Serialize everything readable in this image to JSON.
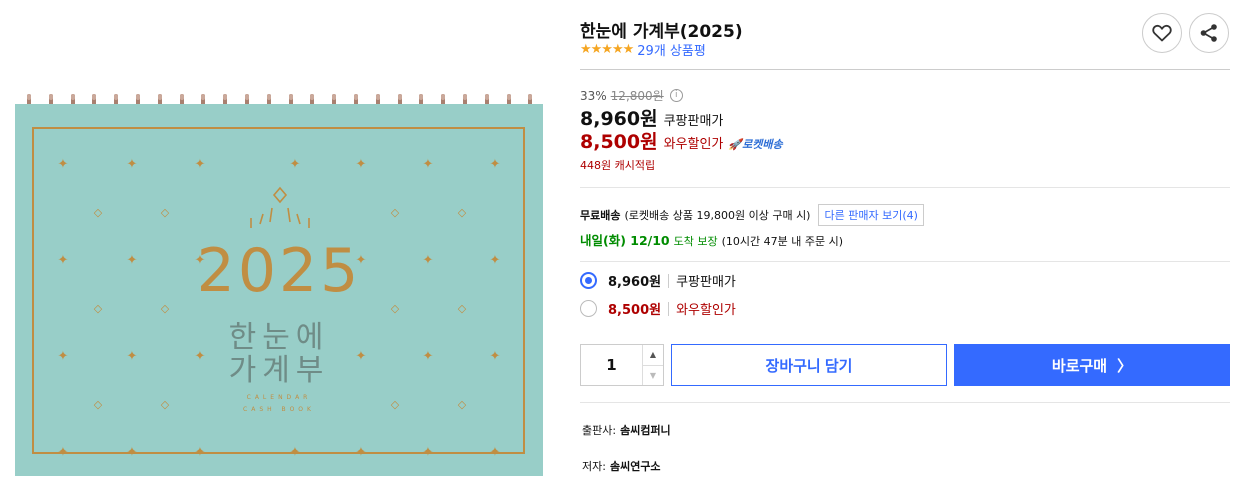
{
  "product": {
    "title": "한눈에 가계부(2025)",
    "stars": "★★★★★",
    "review_count": "29개 상품평",
    "rating": 5
  },
  "image": {
    "year": "2025",
    "title_line1": "한눈에",
    "title_line2": "가계부",
    "sub_line1": "CALENDAR",
    "sub_line2": "CASH BOOK"
  },
  "pricing": {
    "discount_rate": "33%",
    "original_price": "12,800원",
    "info_icon": "i",
    "coupang_price": "8,960원",
    "coupang_label": "쿠팡판매가",
    "wow_price": "8,500원",
    "wow_label": "와우할인가",
    "rocket_badge": "🚀로켓배송",
    "cashback": "448원 캐시적립"
  },
  "shipping": {
    "free_label": "무료배송",
    "condition": "(로켓배송 상품 19,800원 이상 구매 시)",
    "other_sellers": "다른 판매자 보기(4)",
    "arrival_date": "내일(화) 12/10",
    "arrival_guarantee": "도착 보장",
    "arrival_note": "(10시간 47분 내 주문 시)"
  },
  "options": [
    {
      "price": "8,960원",
      "label": "쿠팡판매가",
      "selected": true
    },
    {
      "price": "8,500원",
      "label": "와우할인가",
      "selected": false
    }
  ],
  "purchase": {
    "quantity": "1",
    "cart_label": "장바구니 담기",
    "buy_label": "바로구매",
    "buy_chevron": "〉"
  },
  "meta": {
    "publisher_key": "출판사:",
    "publisher": "솜씨컴퍼니",
    "author_key": "저자:",
    "author": "솜씨연구소"
  },
  "colors": {
    "accent": "#346aff",
    "price_red": "#ae0000",
    "delivery_green": "#008c00",
    "star": "#f5a623",
    "calendar_bg": "#98cec8",
    "calendar_gold": "#c08e43"
  },
  "icons": {
    "wishlist": "heart-icon",
    "share": "share-icon"
  }
}
